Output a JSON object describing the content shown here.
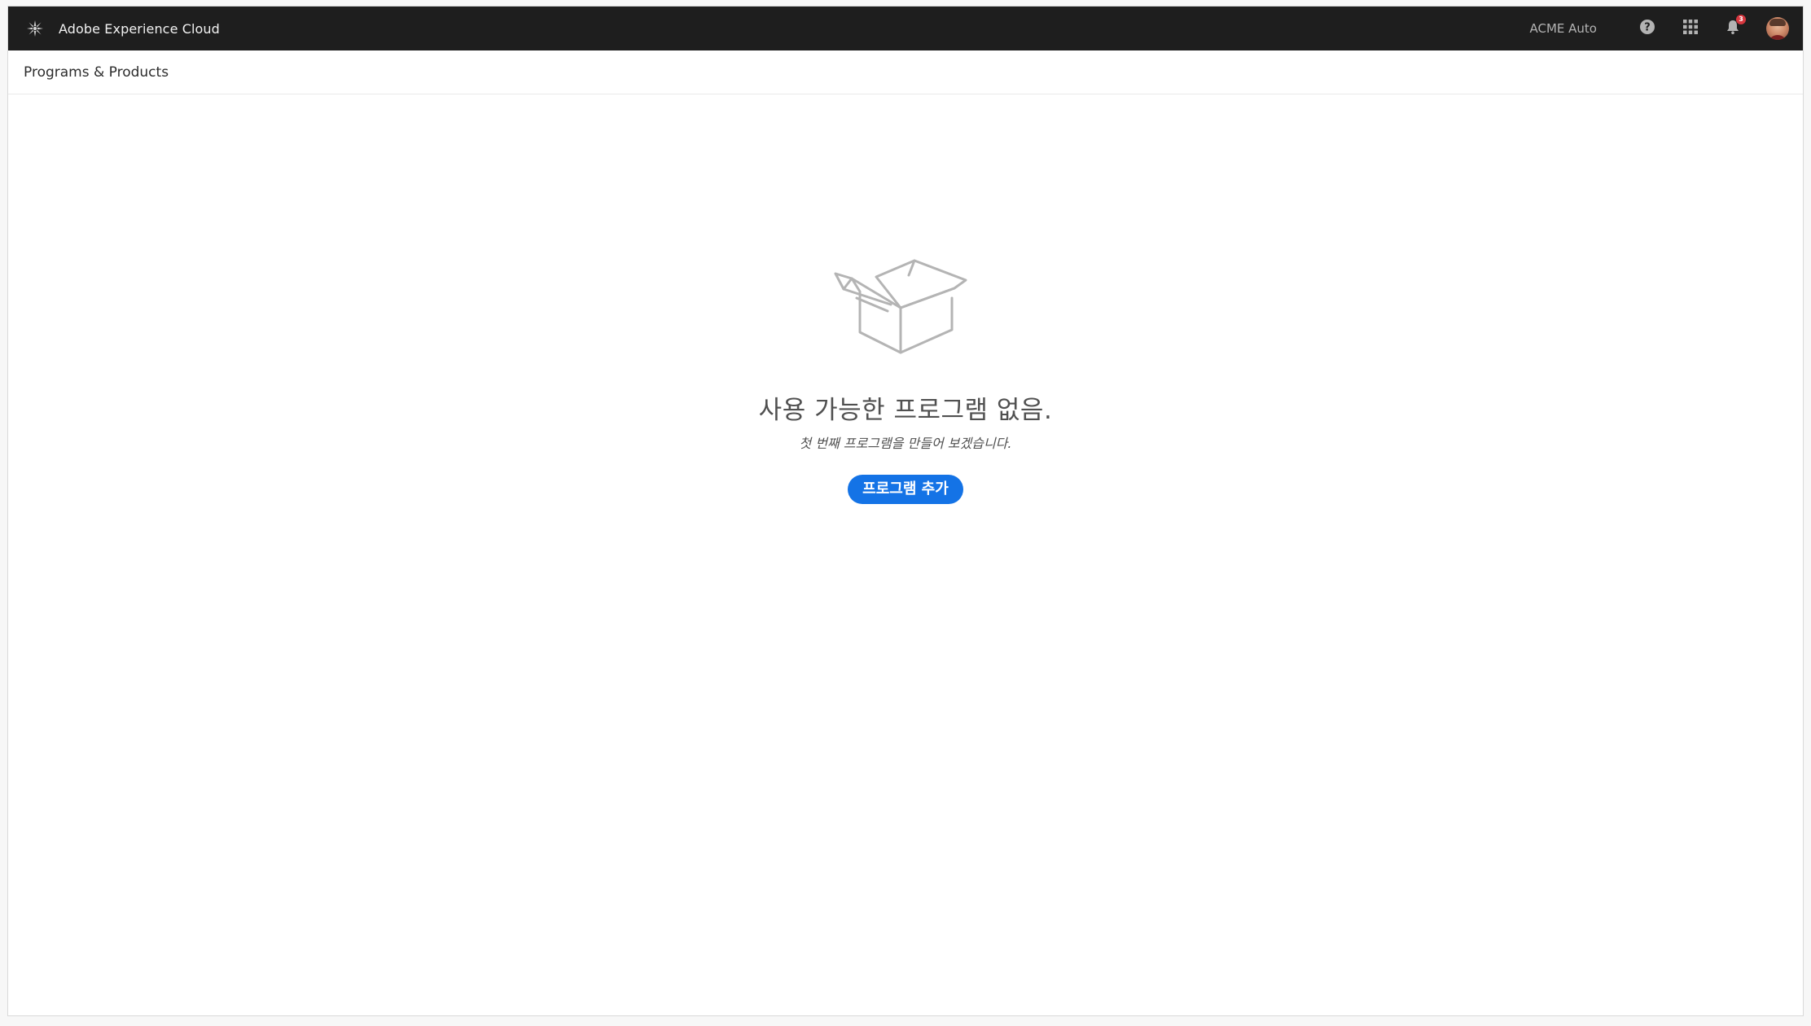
{
  "app": {
    "title": "Adobe Experience Cloud",
    "logo_icon": "experience-cloud-logo-icon"
  },
  "header": {
    "org_name": "ACME Auto",
    "help_icon": "help-icon",
    "apps_icon": "app-switcher-icon",
    "notifications_icon": "bell-icon",
    "notification_count": "3",
    "avatar": "user-avatar"
  },
  "breadcrumb": {
    "title": "Programs & Products"
  },
  "empty_state": {
    "illustration": "empty-box-icon",
    "title": "사용 가능한 프로그램 없음.",
    "subtitle": "첫 번째 프로그램을 만들어 보겠습니다.",
    "button_label": "프로그램 추가"
  },
  "colors": {
    "header_bg": "#1e1e1e",
    "accent": "#1473e6",
    "badge": "#d7373f"
  }
}
